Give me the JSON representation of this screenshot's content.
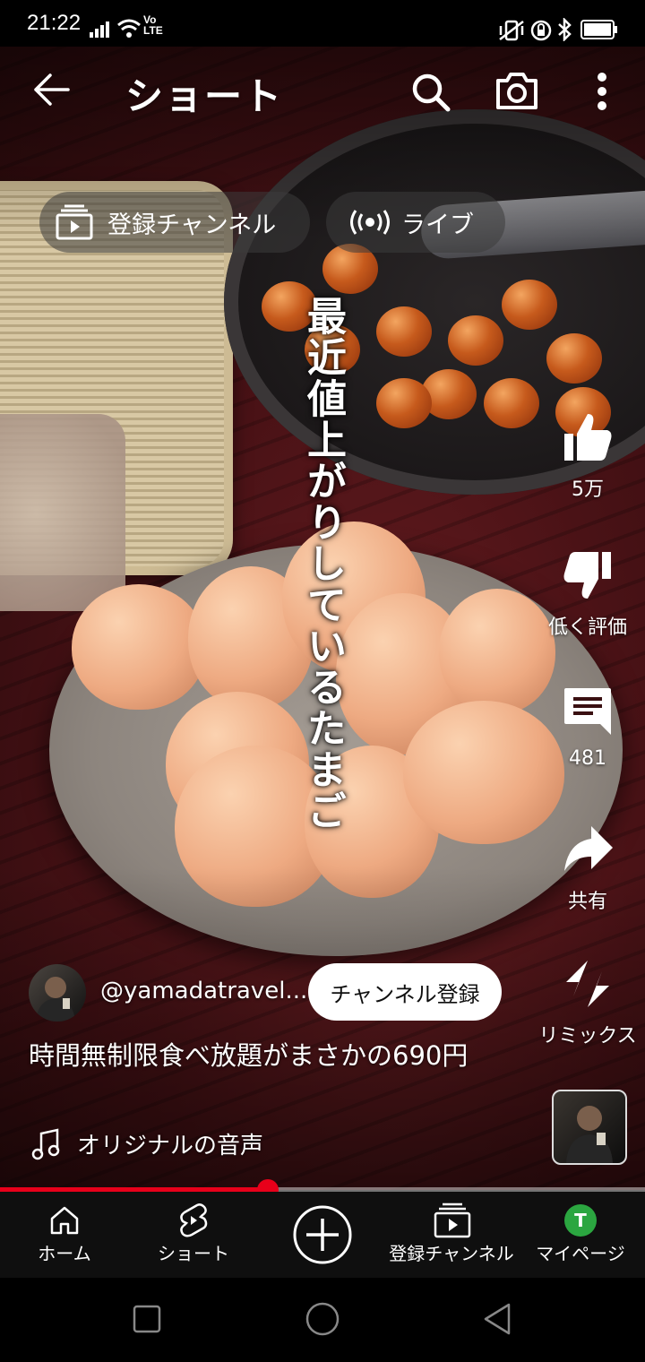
{
  "status_bar": {
    "time": "21:22",
    "network": "Vo LTE",
    "icons": [
      "signal-icon",
      "wifi-icon",
      "volte-icon",
      "vibrate-icon",
      "rotation-lock-icon",
      "bluetooth-icon",
      "battery-icon"
    ]
  },
  "header": {
    "title": "ショート",
    "back_icon": "arrow-left-icon",
    "search_icon": "search-icon",
    "camera_icon": "camera-icon",
    "more_icon": "more-vert-icon"
  },
  "chips": {
    "subscriptions_label": "登録チャンネル",
    "live_label": "ライブ"
  },
  "video": {
    "caption": "最近値上がりしているたまご"
  },
  "actions": {
    "like_count": "5万",
    "dislike_label": "低く評価",
    "comment_count": "481",
    "share_label": "共有",
    "remix_label": "リミックス"
  },
  "channel": {
    "handle": "@yamadatravel...",
    "subscribe_label": "チャンネル登録"
  },
  "short": {
    "title": "時間無制限食べ放題がまさかの690円",
    "audio_label": "オリジナルの音声"
  },
  "progress": {
    "fraction": 0.415
  },
  "nav": {
    "home": "ホーム",
    "shorts": "ショート",
    "create_icon": "plus-circle-icon",
    "subscriptions": "登録チャンネル",
    "you": "マイページ",
    "avatar_letter": "T",
    "avatar_color": "#2ba640"
  },
  "colors": {
    "accent_red": "#e8001a",
    "nav_bg": "#0f0f0f"
  }
}
